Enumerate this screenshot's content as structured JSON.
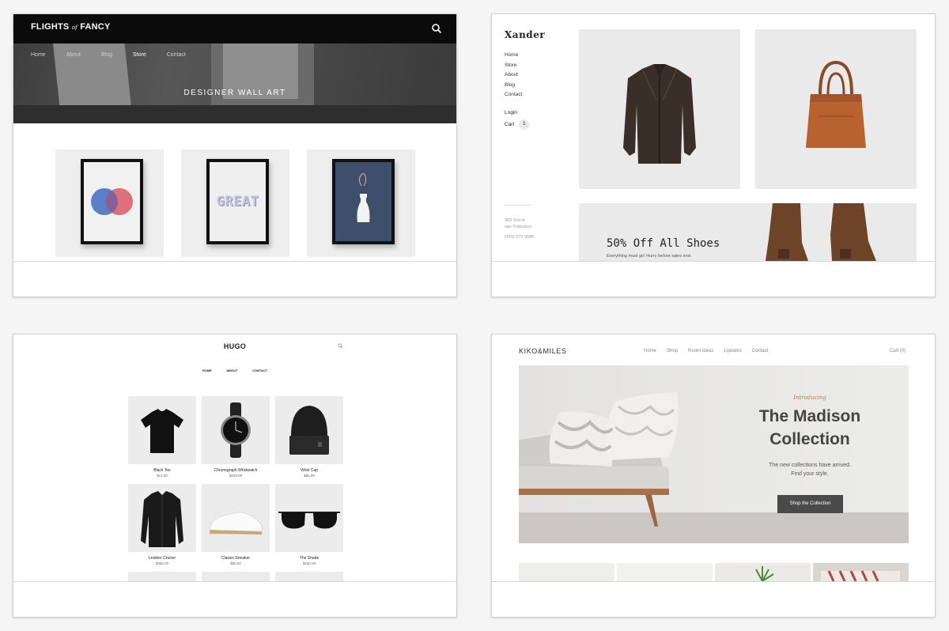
{
  "flights": {
    "logo_main": "FLIGHTS",
    "logo_of": "of",
    "logo_end": "FANCY",
    "nav": [
      "Home",
      "About",
      "Blog",
      "Store",
      "Contact"
    ],
    "hero_title": "DESIGNER WALL ART",
    "great_text": "GREAT"
  },
  "xander": {
    "logo": "Xander",
    "nav": [
      "Home",
      "Store",
      "About",
      "Blog",
      "Contact"
    ],
    "login": "Login",
    "cart": "Cart",
    "cart_count": "1",
    "address_1": "303 2nd st",
    "address_2": "san Francisco",
    "phone": "(415) 672 9585",
    "banner_title": "50% Off All Shoes",
    "banner_subtitle": "Everything must go! Hurry before sales end."
  },
  "hugo": {
    "logo": "HUGO",
    "nav": [
      "HOME",
      "ABOUT",
      "CONTACT"
    ],
    "products": [
      {
        "name": "Black Tee",
        "price": "$14.00"
      },
      {
        "name": "Chronograph Wristwatch",
        "price": "$225.00"
      },
      {
        "name": "Wool Cap",
        "price": "$65.00"
      },
      {
        "name": "Leather Cruiser",
        "price": "$350.00"
      },
      {
        "name": "Classic Sneaker",
        "price": "$65.00"
      },
      {
        "name": "The Shade",
        "price": "$150.00"
      }
    ]
  },
  "kiko": {
    "logo": "KIKO&MILES",
    "nav": [
      "Home",
      "Shop",
      "Room Ideas",
      "Updates",
      "Contact"
    ],
    "cart": "Cart (0)",
    "intro": "Introducing",
    "title_line1": "The Madison",
    "title_line2": "Collection",
    "subtitle_line1": "The new collections have arrived.",
    "subtitle_line2": "Find your style.",
    "button": "Shop the Collection"
  },
  "colors": {
    "page_bg": "#f5f5f5",
    "venn_blue": "#5b7fc4",
    "venn_red": "#d9636f",
    "poster_navy": "#3d4f6a",
    "leather_brown": "#3a2f28",
    "bag_tan": "#b8622f",
    "kiko_accent": "#b77b4a",
    "kiko_button": "#4a4a4a"
  }
}
